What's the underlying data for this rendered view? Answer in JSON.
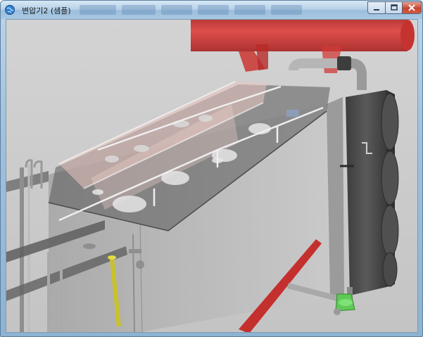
{
  "window": {
    "title": "변압기2 (샘플)",
    "icon": "globe-icon",
    "controls": {
      "minimize_icon": "minimize-icon",
      "maximize_icon": "maximize-icon",
      "close_icon": "close-icon"
    }
  },
  "scene": {
    "description_icon": "3d-viewport",
    "colors": {
      "background": "#cfcfcf",
      "tank_body": "#b9b9b9",
      "conservator_red": "#d9312f",
      "radiator_dark": "#4a4a4a",
      "yellow_pipe": "#c8c229",
      "green_valve": "#58c54f",
      "pink_tint": "#e7b9b4"
    }
  }
}
